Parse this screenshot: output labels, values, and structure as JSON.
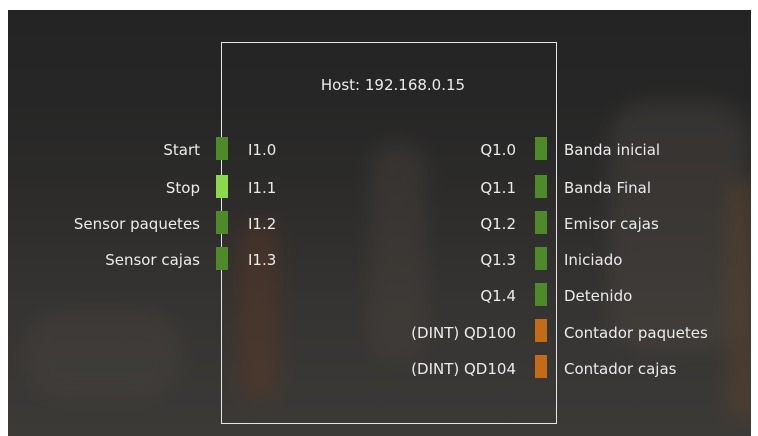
{
  "host": {
    "label": "Host: 192.168.0.15"
  },
  "inputs": [
    {
      "name": "Start",
      "address": "I1.0",
      "color": "#4f8a2a"
    },
    {
      "name": "Stop",
      "address": "I1.1",
      "color": "#8bd84a"
    },
    {
      "name": "Sensor paquetes",
      "address": "I1.2",
      "color": "#4f8a2a"
    },
    {
      "name": "Sensor cajas",
      "address": "I1.3",
      "color": "#4f8a2a"
    }
  ],
  "outputs": [
    {
      "address": "Q1.0",
      "name": "Banda inicial",
      "color": "#4f8a2a"
    },
    {
      "address": "Q1.1",
      "name": "Banda Final",
      "color": "#4f8a2a"
    },
    {
      "address": "Q1.2",
      "name": "Emisor cajas",
      "color": "#4f8a2a"
    },
    {
      "address": "Q1.3",
      "name": "Iniciado",
      "color": "#4f8a2a"
    },
    {
      "address": "Q1.4",
      "name": "Detenido",
      "color": "#4f8a2a"
    },
    {
      "address": "(DINT) QD100",
      "name": "Contador paquetes",
      "color": "#c46b15"
    },
    {
      "address": "(DINT) QD104",
      "name": "Contador cajas",
      "color": "#c46b15"
    }
  ]
}
